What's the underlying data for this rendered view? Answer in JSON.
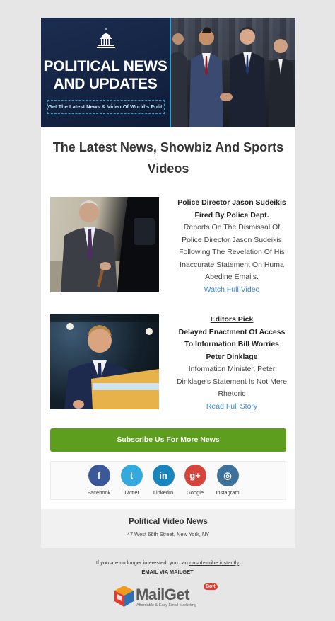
{
  "hero": {
    "title_line1": "POLITICAL NEWS",
    "title_line2": "AND UPDATES",
    "subtitle": "Get The Latest News & Video Of World's Politics"
  },
  "headline": {
    "line1": "The Latest News, Showbiz And Sports",
    "line2": "Videos"
  },
  "stories": [
    {
      "title_lines": [
        "Police Director Jason Sudeikis",
        "Fired By Police Dept."
      ],
      "body_lines": [
        "Reports On The Dismissal Of",
        "Police Director Jason Sudeikis",
        "Following The Revelation Of His",
        "Inaccurate Statement On Huma",
        "Abedine Emails."
      ],
      "link": "Watch Full Video"
    },
    {
      "pick": "Editors Pick",
      "title_lines": [
        "Delayed Enactment Of Access",
        "To Information Bill Worries",
        "Peter Dinklage"
      ],
      "body_lines": [
        "Information Minister, Peter",
        "Dinklage's Statement Is Not Mere",
        "Rhetoric"
      ],
      "link": "Read Full Story"
    }
  ],
  "subscribe_label": "Subscribe Us For More News",
  "social": [
    {
      "label": "Facebook",
      "glyph": "f",
      "color": "#3b5998",
      "icon": "facebook-icon"
    },
    {
      "label": "Twitter",
      "glyph": "t",
      "color": "#33a9dd",
      "icon": "twitter-icon"
    },
    {
      "label": "LinkedIn",
      "glyph": "in",
      "color": "#1a84bc",
      "icon": "linkedin-icon"
    },
    {
      "label": "Google",
      "glyph": "g+",
      "color": "#d6453d",
      "icon": "google-plus-icon"
    },
    {
      "label": "Instagram",
      "glyph": "◎",
      "color": "#3f729b",
      "icon": "instagram-icon"
    }
  ],
  "footer": {
    "title": "Political Video News",
    "address": "47 West 66th Street, New York, NY"
  },
  "unsubscribe": {
    "prefix": "If you are no longer interested, you can",
    "link": "unsubscribe instantly"
  },
  "via": "EMAIL VIA MAILGET",
  "brand": {
    "name": "MailGet",
    "badge": "Bolt",
    "tagline": "Affordable & Easy Email Marketing"
  }
}
